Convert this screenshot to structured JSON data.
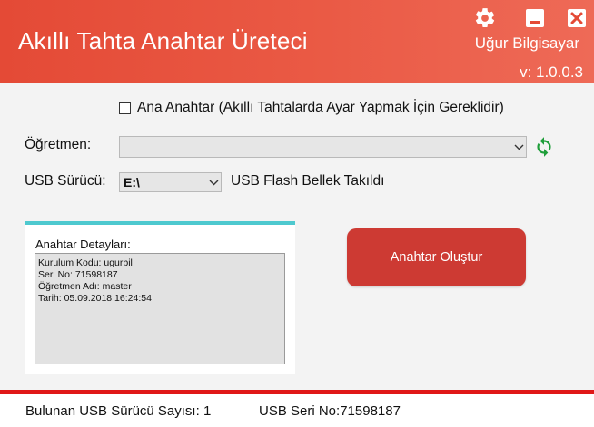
{
  "header": {
    "title": "Akıllı Tahta Anahtar Üreteci",
    "company": "Uğur Bilgisayar",
    "version": "v: 1.0.0.3",
    "bg_color": "#e44a36"
  },
  "form": {
    "master_key_label": "Ana Anahtar (Akıllı Tahtalarda Ayar Yapmak İçin Gereklidir)",
    "master_key_checked": false,
    "teacher_label": "Öğretmen:",
    "teacher_value": "",
    "usb_label": "USB Sürücü:",
    "usb_value": "E:\\",
    "usb_status": "USB Flash Bellek Takıldı"
  },
  "details": {
    "title": "Anahtar Detayları:",
    "lines": [
      "Kurulum Kodu: ugurbil",
      "Seri No: 71598187",
      "Öğretmen Adı: master",
      "Tarih: 05.09.2018 16:24:54"
    ],
    "accent_color": "#4ec9cf"
  },
  "actions": {
    "generate_label": "Anahtar Oluştur",
    "generate_color": "#cd3a33"
  },
  "footer": {
    "usb_count": "Bulunan USB Sürücü Sayısı: 1",
    "usb_serial": "USB Seri No:71598187"
  },
  "icons": {
    "settings": "gear-icon",
    "minimize": "minimize-icon",
    "close": "close-icon",
    "refresh": "refresh-icon",
    "dropdown": "chevron-down-icon"
  }
}
